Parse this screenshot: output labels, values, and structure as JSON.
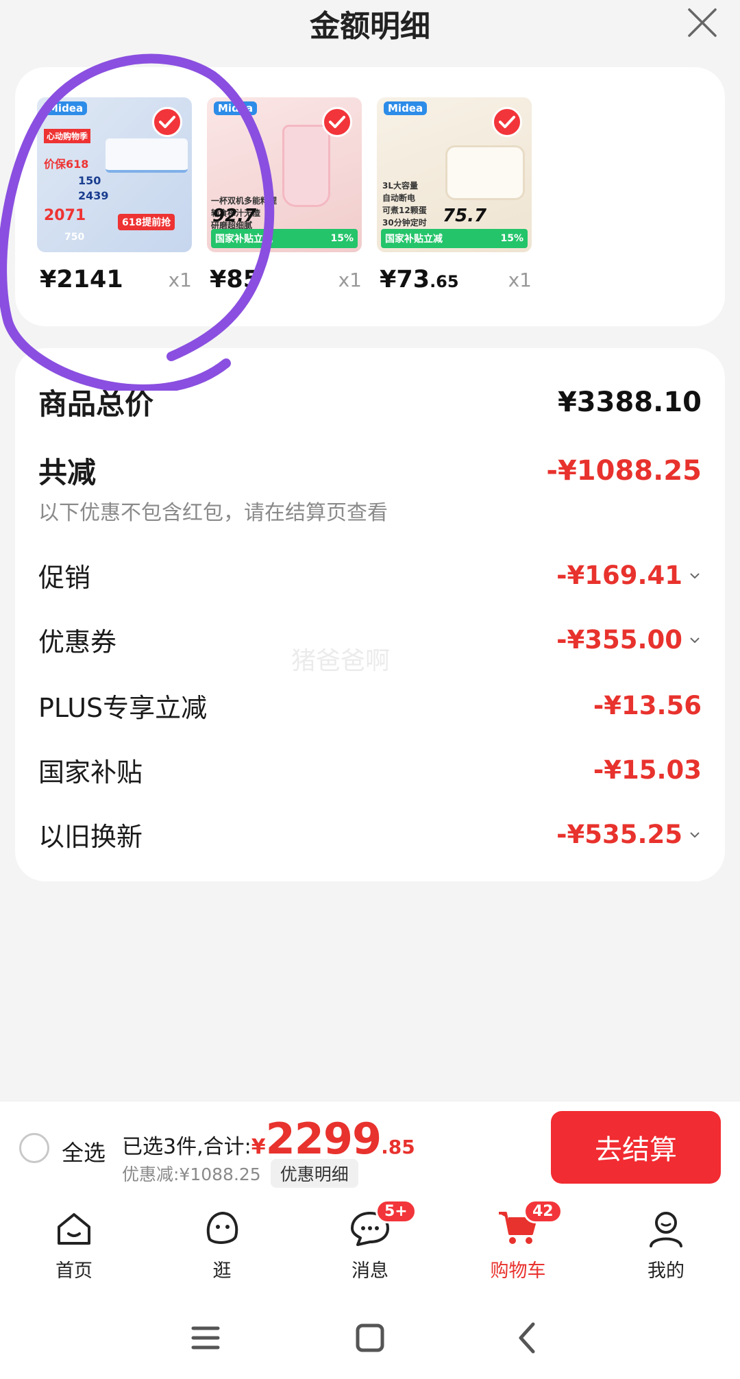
{
  "header": {
    "title": "金额明细",
    "close_icon": "close-icon"
  },
  "products": [
    {
      "price_int": "¥2141",
      "price_dec": "",
      "qty": "x1",
      "thumb": {
        "brand": "Midea",
        "lines": [
          "心动购物季",
          "价保618",
          "150",
          "2439",
          "2071",
          "750"
        ],
        "promo": "618提前抢",
        "bg": "#e9eef6"
      }
    },
    {
      "price_int": "¥85",
      "price_dec": "",
      "qty": "x1",
      "thumb": {
        "brand": "Midea",
        "lines": [
          "一杯双机多能料理",
          "辅食榨汁无渣",
          "研磨超细腻"
        ],
        "promo_left": "国家补贴立减",
        "promo_right": "15%",
        "price": "92.7",
        "bg": "#f6dede"
      }
    },
    {
      "price_int": "¥73",
      "price_dec": ".65",
      "qty": "x1",
      "thumb": {
        "brand": "Midea",
        "lines": [
          "3L大容量",
          "自动断电",
          "可煮12颗蛋",
          "30分钟定时"
        ],
        "promo_left": "国家补贴立减",
        "promo_right": "15%",
        "price": "75.7",
        "bg": "#f3eee4"
      }
    }
  ],
  "summary": {
    "total_label": "商品总价",
    "total_value": "¥3388.10",
    "reduce_label": "共减",
    "reduce_value": "-¥1088.25",
    "note": "以下优惠不包含红包，请在结算页查看",
    "items": [
      {
        "label": "促销",
        "value": "-¥169.41",
        "expandable": true
      },
      {
        "label": "优惠券",
        "value": "-¥355.00",
        "expandable": true
      },
      {
        "label": "PLUS专享立减",
        "value": "-¥13.56",
        "expandable": false
      },
      {
        "label": "国家补贴",
        "value": "-¥15.03",
        "expandable": false
      },
      {
        "label": "以旧换新",
        "value": "-¥535.25",
        "expandable": true
      }
    ]
  },
  "watermark": "猪爸爸啊",
  "checkout": {
    "select_all": "全选",
    "selected_text": "已选3件,合计:",
    "currency": "¥",
    "total_int": "2299",
    "total_dec": ".85",
    "discount_text": "优惠减:¥1088.25",
    "detail_button": "优惠明细",
    "submit_button": "去结算"
  },
  "tabs": [
    {
      "label": "首页",
      "icon": "home-icon",
      "active": false
    },
    {
      "label": "逛",
      "icon": "browse-face-icon",
      "active": false
    },
    {
      "label": "消息",
      "icon": "message-icon",
      "badge": "5+",
      "active": false
    },
    {
      "label": "购物车",
      "icon": "cart-icon",
      "badge": "42",
      "active": true
    },
    {
      "label": "我的",
      "icon": "profile-icon",
      "active": false
    }
  ],
  "colors": {
    "accent": "#e8322d",
    "annotation": "#8a4fe0"
  }
}
